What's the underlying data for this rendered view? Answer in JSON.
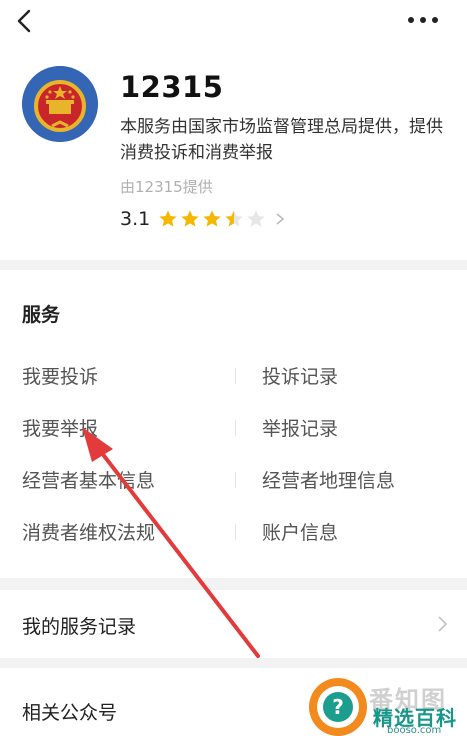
{
  "header": {
    "back_icon": "chevron-left-icon",
    "more_icon": "ellipsis-icon"
  },
  "profile": {
    "title": "12315",
    "description": "本服务由国家市场监督管理总局提供，提供消费投诉和消费举报",
    "provider": "由12315提供",
    "rating": "3.1",
    "stars": 3.5,
    "stars_max": 5,
    "star_color": "#f5b800"
  },
  "services": {
    "title": "服务",
    "items": [
      {
        "label": "我要投诉"
      },
      {
        "label": "投诉记录"
      },
      {
        "label": "我要举报"
      },
      {
        "label": "举报记录"
      },
      {
        "label": "经营者基本信息"
      },
      {
        "label": "经营者地理信息"
      },
      {
        "label": "消费者维权法规"
      },
      {
        "label": "账户信息"
      }
    ]
  },
  "my_records": {
    "label": "我的服务记录"
  },
  "related": {
    "label": "相关公众号"
  },
  "watermark": {
    "faint_text": "番知图",
    "main_text": "精选百科",
    "url": "booso.com",
    "brand_color": "#18968a"
  },
  "colors": {
    "arrow": "#e33b3b",
    "emblem_bg": "#3566b5"
  }
}
